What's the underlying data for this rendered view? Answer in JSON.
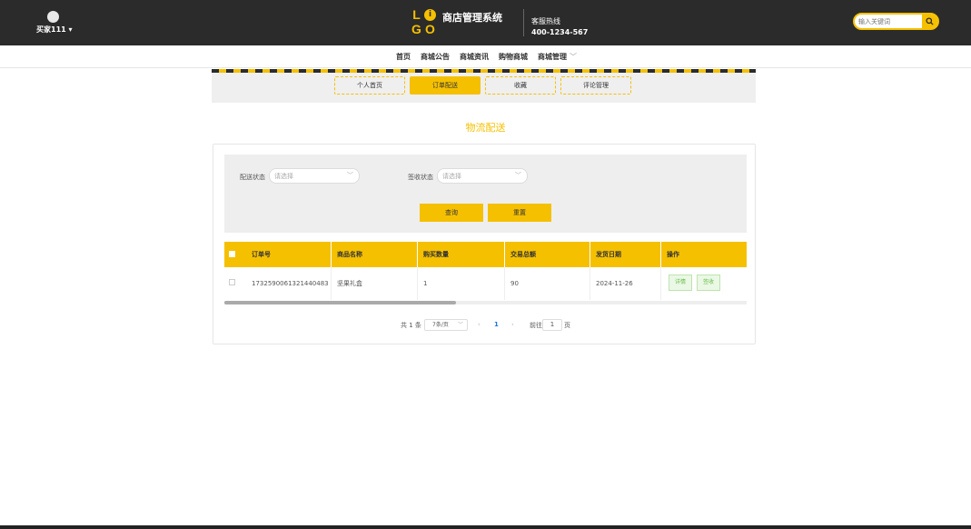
{
  "header": {
    "user_name": "买家111",
    "user_caret": "▾",
    "logo_letters": [
      "L",
      "i",
      "G",
      "O"
    ],
    "system_title": "商店管理系统",
    "hotline_label": "客服热线",
    "hotline_number": "400-1234-567",
    "search_placeholder": "输入关键词"
  },
  "nav": {
    "items": [
      "首页",
      "商城公告",
      "商城资讯",
      "购物商城",
      "商城管理"
    ]
  },
  "tabs": [
    {
      "label": "个人首页",
      "active": false
    },
    {
      "label": "订单配送",
      "active": true
    },
    {
      "label": "收藏",
      "active": false
    },
    {
      "label": "评论管理",
      "active": false
    }
  ],
  "section_title": "物流配送",
  "filters": {
    "delivery_label": "配送状态",
    "delivery_placeholder": "请选择",
    "receipt_label": "签收状态",
    "receipt_placeholder": "请选择",
    "query_button": "查询",
    "reset_button": "重置"
  },
  "table": {
    "columns": [
      "订单号",
      "商品名称",
      "购买数量",
      "交易总额",
      "发货日期",
      "操作"
    ],
    "rows": [
      {
        "order_no": "1732590061321440483",
        "product": "坚果礼盒",
        "qty": "1",
        "total": "90",
        "ship_date": "2024-11-26",
        "actions": [
          "详情",
          "签收"
        ]
      }
    ]
  },
  "pagination": {
    "total": "共 1 条",
    "page_size": "7条/页",
    "current_page": "1",
    "goto_label": "前往",
    "goto_value": "1",
    "page_suffix": "页"
  },
  "colors": {
    "accent": "#f5c000",
    "topbar": "#2b2b2b",
    "success": "#6cbc4b"
  }
}
